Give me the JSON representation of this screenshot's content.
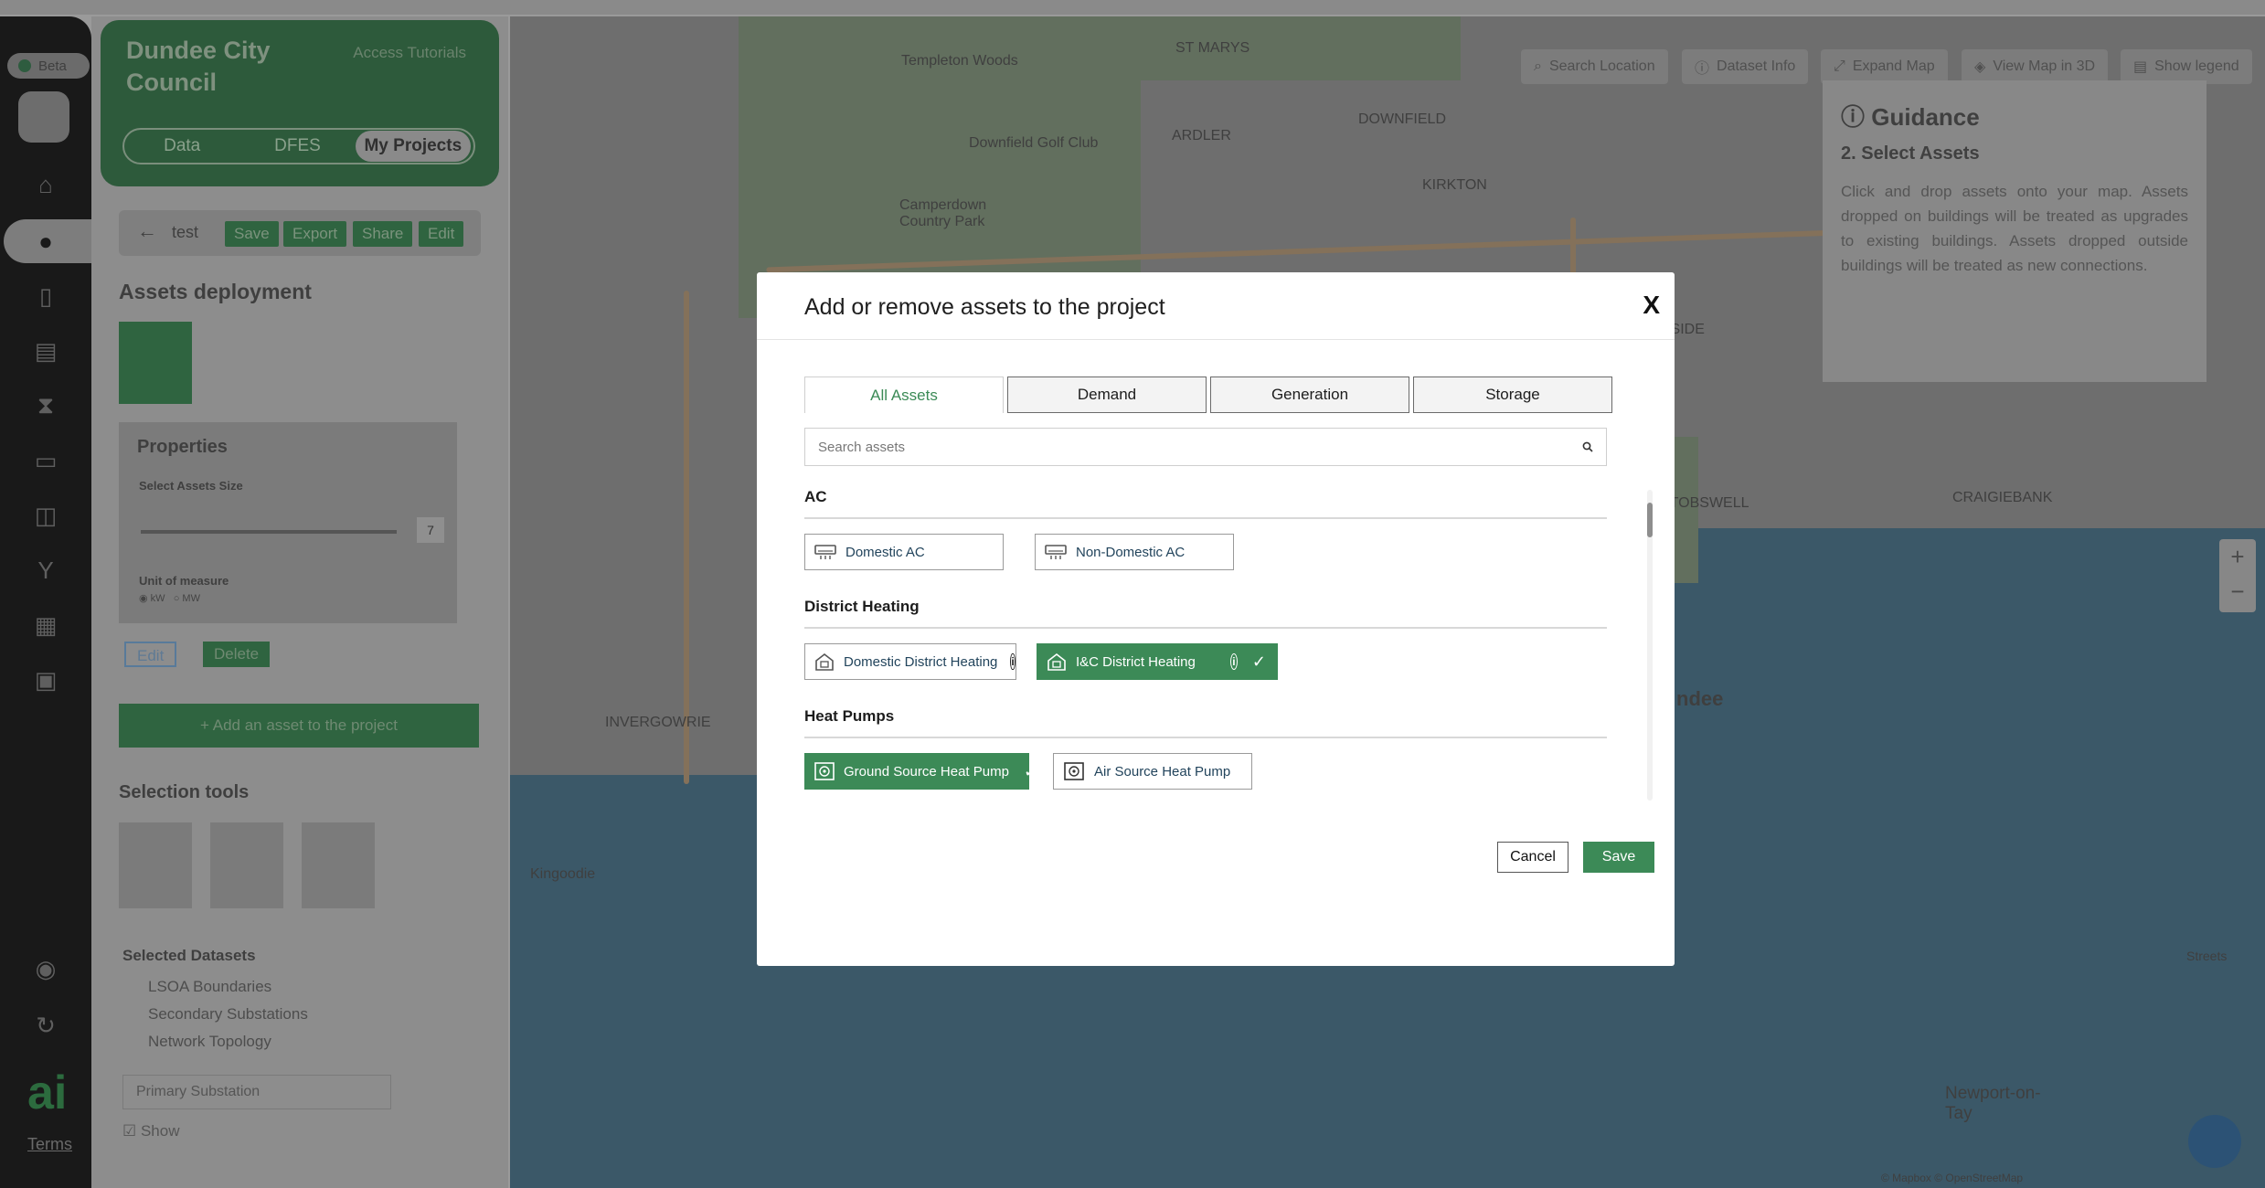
{
  "beta_label": "Beta",
  "council": {
    "name": "Dundee City Council",
    "tutorials": "Access Tutorials",
    "tabs": [
      "Data",
      "DFES",
      "My Projects"
    ],
    "active_tab": "My Projects"
  },
  "project": {
    "name": "test",
    "buttons": [
      "Save",
      "Export",
      "Share",
      "Edit"
    ]
  },
  "side": {
    "assets_deployment": "Assets deployment",
    "properties": "Properties",
    "select_size": "Select Assets Size",
    "size_value": "7",
    "unit_label": "Unit of measure",
    "units": [
      "kW",
      "MW"
    ],
    "edit": "Edit",
    "delete": "Delete",
    "add_asset": "+ Add an asset to the project",
    "selection_tools": "Selection tools",
    "selected_datasets": "Selected Datasets",
    "datasets": [
      "LSOA Boundaries",
      "Secondary Substations",
      "Network Topology"
    ],
    "dropdown": "Primary Substation",
    "show": "Show",
    "terms": "Terms",
    "ai_logo": "ai"
  },
  "map": {
    "buttons": [
      "Search Location",
      "Dataset Info",
      "Expand Map",
      "View Map in 3D",
      "Show legend"
    ],
    "labels": [
      "Templeton Woods",
      "Downfield Golf Club",
      "Camperdown Country Park",
      "ST MARYS",
      "DOWNFIELD",
      "ARDLER",
      "KIRKTON",
      "WOODSIDE",
      "STOBSWELL",
      "CRAIGIEBANK",
      "INVERGOWRIE",
      "Kingoodie",
      "ndee",
      "Newport-on-Tay",
      "Streets",
      "© Mapbox © OpenStreetMap"
    ]
  },
  "guidance": {
    "title": "Guidance",
    "step": "2. Select Assets",
    "body": "Click and drop assets onto your map. Assets dropped on buildings will be treated as upgrades to existing buildings. Assets dropped outside buildings will be treated as new connections."
  },
  "modal": {
    "title": "Add or remove assets to the project",
    "close": "X",
    "tabs": [
      "All Assets",
      "Demand",
      "Generation",
      "Storage"
    ],
    "active_tab": "All Assets",
    "search_placeholder": "Search assets",
    "categories": [
      {
        "title": "AC",
        "items": [
          {
            "label": "Domestic AC",
            "icon": "ac-unit-icon",
            "selected": false,
            "info": false
          },
          {
            "label": "Non-Domestic AC",
            "icon": "ac-unit-icon",
            "selected": false,
            "info": false
          }
        ]
      },
      {
        "title": "District Heating",
        "items": [
          {
            "label": "Domestic District Heating",
            "icon": "house-heat-icon",
            "selected": false,
            "info": true
          },
          {
            "label": "I&C District Heating",
            "icon": "house-heat-icon",
            "selected": true,
            "info": true
          }
        ]
      },
      {
        "title": "Heat Pumps",
        "items": [
          {
            "label": "Ground Source Heat Pump",
            "icon": "heat-pump-icon",
            "selected": true,
            "info": false
          },
          {
            "label": "Air Source Heat Pump",
            "icon": "heat-pump-icon",
            "selected": false,
            "info": false
          }
        ]
      }
    ],
    "cancel": "Cancel",
    "save": "Save"
  },
  "colors": {
    "accent_green": "#3c8a57",
    "modal_bg": "#ffffff",
    "overlay": "#808080"
  }
}
